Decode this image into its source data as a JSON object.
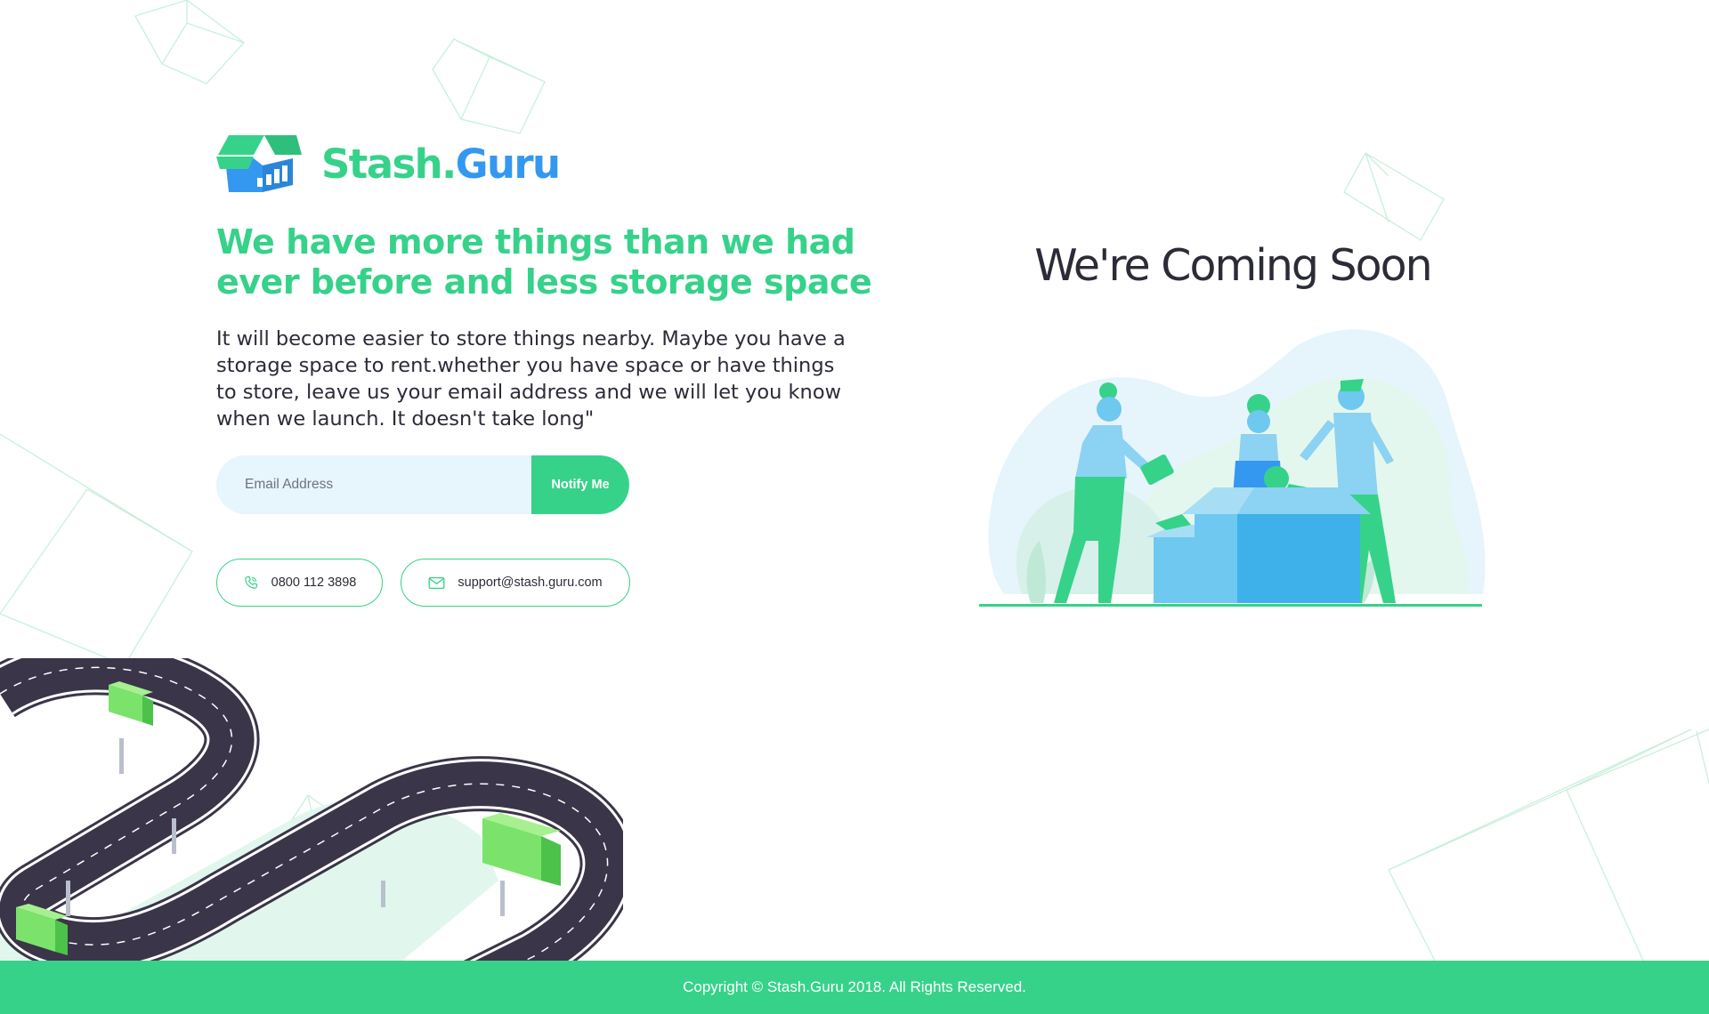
{
  "brand": {
    "name_part1": "Stash.",
    "name_part2": "Guru",
    "colors": {
      "green": "#36d28a",
      "blue": "#3498f0",
      "text": "#2c2c38"
    }
  },
  "hero": {
    "headline": "We have more things than we had ever before and less storage space",
    "description": "It will become easier to store things nearby. Maybe you have a storage space to rent.whether you have space or have things to store, leave us your email address and we will let you know when we launch. It doesn't take long\""
  },
  "signup": {
    "email_placeholder": "Email Address",
    "button_label": "Notify Me"
  },
  "contact": {
    "phone": "0800 112 3898",
    "phone_icon": "phone-icon",
    "email": "support@stash.guru.com",
    "email_icon": "envelope-icon"
  },
  "status": {
    "title": "We're Coming Soon"
  },
  "footer": {
    "copyright": "Copyright © Stash.Guru 2018. All Rights Reserved."
  }
}
